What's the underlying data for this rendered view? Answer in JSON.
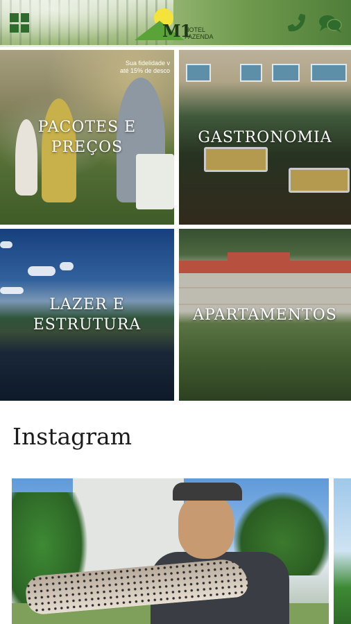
{
  "header": {
    "logo_text": "M1",
    "logo_subtext": "HOTEL\nFAZENDA",
    "menu_icon": "grid-menu-icon",
    "phone_icon": "phone-icon",
    "chat_icon": "chat-icon",
    "brand_color": "#4f7e3a"
  },
  "tiles": [
    {
      "label": "PACOTES E\nPREÇOS"
    },
    {
      "label": "GASTRONOMIA"
    },
    {
      "label": "LAZER E\nESTRUTURA"
    },
    {
      "label": "APARTAMENTOS"
    }
  ],
  "promo": {
    "line1": "Sua fidelidade v",
    "line2": "até 15% de desco"
  },
  "instagram": {
    "title": "Instagram"
  }
}
